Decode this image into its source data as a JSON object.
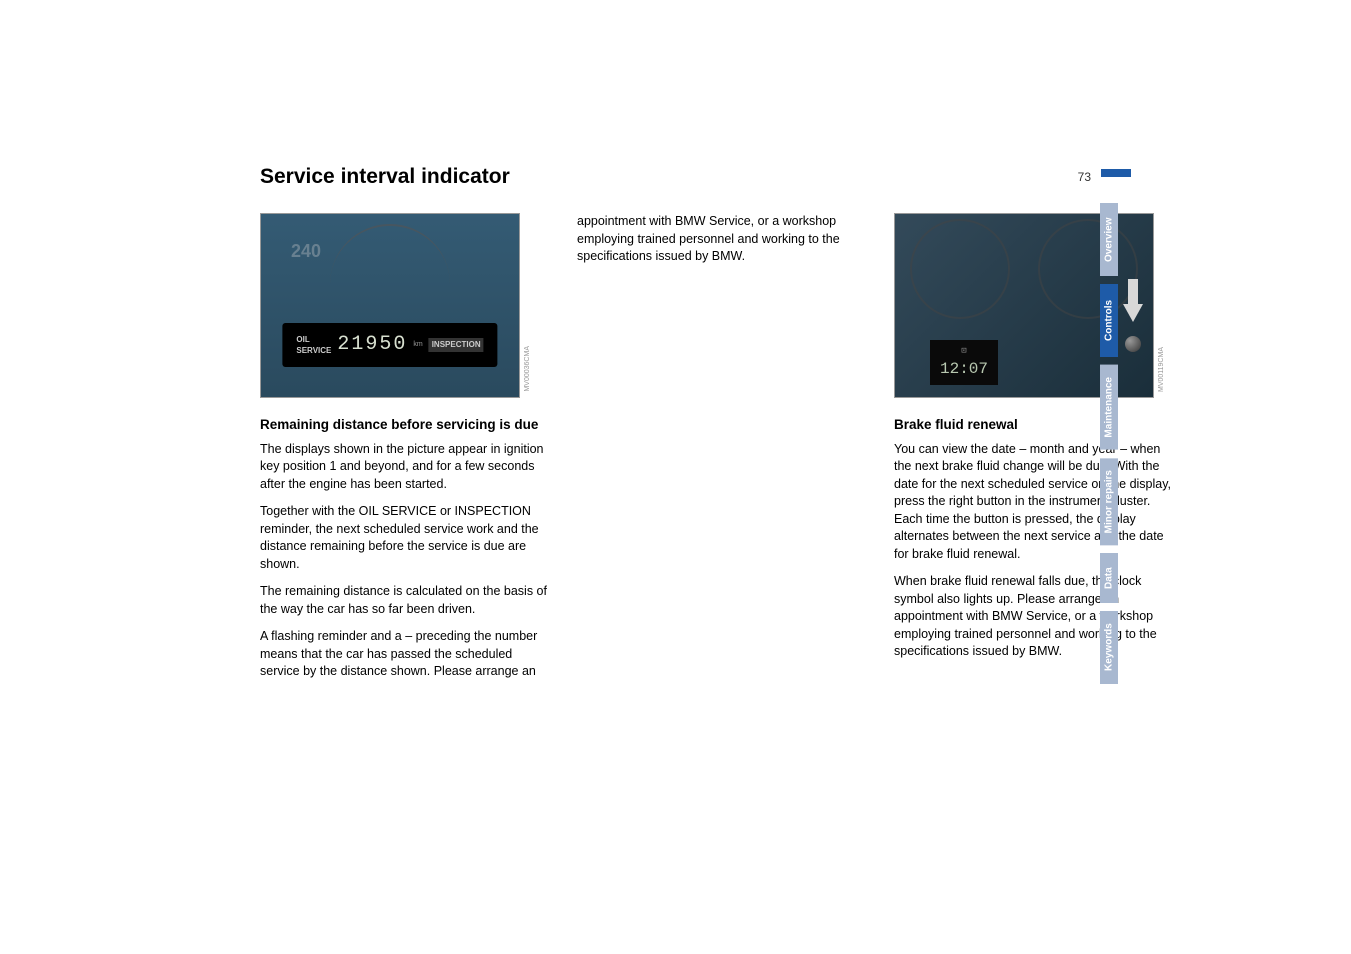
{
  "page": {
    "title": "Service interval indicator",
    "number": "73"
  },
  "figure1": {
    "oil_service": "OIL SERVICE",
    "mileage": "21950",
    "unit": "km",
    "inspection": "INSPECTION",
    "speedo": "240",
    "ref": "MV00036CMA"
  },
  "figure2": {
    "time": "12:07",
    "ref": "MV00119CMA"
  },
  "section1": {
    "heading": "Remaining distance before servicing is due",
    "p1": "The displays shown in the picture appear in ignition key position 1 and beyond, and for a few seconds after the engine has been started.",
    "p2": "Together with the OIL SERVICE or INSPECTION reminder, the next scheduled service work and the distance remaining before the service is due are shown.",
    "p3": "The remaining distance is calculated on the basis of the way the car has so far been driven.",
    "p4": "A flashing reminder and a – preceding the number means that the car has passed the scheduled service by the distance shown. Please arrange an"
  },
  "column2": {
    "p1": "appointment with BMW Service, or a workshop employing trained personnel and working to the specifications issued by BMW."
  },
  "section2": {
    "heading": "Brake fluid renewal",
    "p1": "You can view the date – month and year – when the next brake fluid change will be due. With the date for the next scheduled service on the display, press the right button in the instrument cluster. Each time the button is pressed, the display alternates between the next service and the date for brake fluid renewal.",
    "p2": "When brake fluid renewal falls due, the clock symbol also lights up. Please arrange an appointment with BMW Service, or a workshop employing trained personnel and working to the specifications issued by BMW."
  },
  "tabs": {
    "overview": "Overview",
    "controls": "Controls",
    "maintenance": "Maintenance",
    "minor": "Minor repairs",
    "data": "Data",
    "keywords": "Keywords"
  }
}
